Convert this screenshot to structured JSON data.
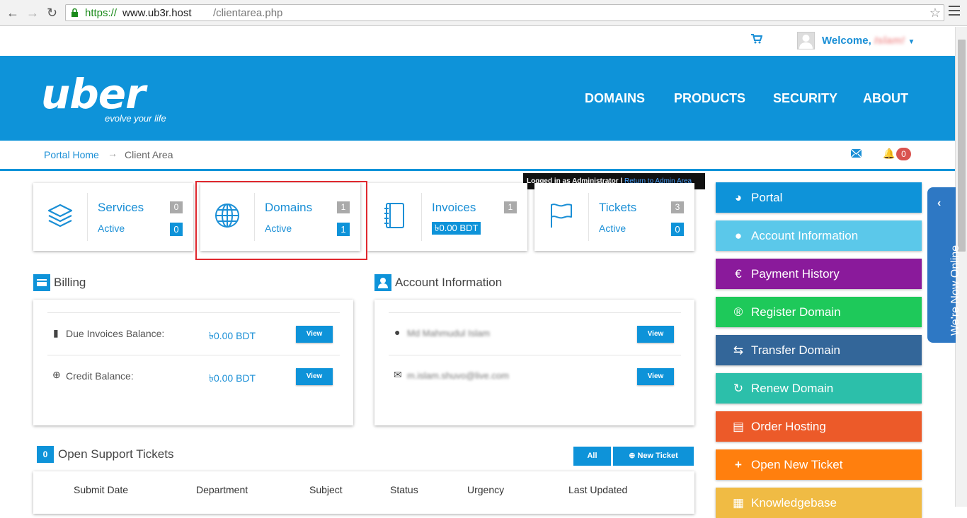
{
  "browser": {
    "url_scheme": "https://",
    "url_host": "www.ub3r.host",
    "url_path": "/clientarea.php"
  },
  "topbar": {
    "welcome_label": "Welcome,",
    "username": "Islam!"
  },
  "logo": {
    "wordmark": "uber",
    "tagline": "evolve your life"
  },
  "nav": [
    "DOMAINS",
    "PRODUCTS",
    "SECURITY",
    "ABOUT"
  ],
  "breadcrumb": {
    "home": "Portal Home",
    "separator": "→",
    "current": "Client Area"
  },
  "notifications": {
    "count": "0"
  },
  "admin_banner": {
    "text": "Logged in as Administrator",
    "separator": "|",
    "link": "Return to Admin Area"
  },
  "tiles": [
    {
      "title": "Services",
      "count": "0",
      "sub": "Active",
      "value": "0",
      "icon": "layers-icon"
    },
    {
      "title": "Domains",
      "count": "1",
      "sub": "Active",
      "value": "1",
      "icon": "globe-icon"
    },
    {
      "title": "Invoices",
      "count": "1",
      "amount": "৳0.00 BDT",
      "icon": "notebook-icon"
    },
    {
      "title": "Tickets",
      "count": "3",
      "sub": "Active",
      "value": "0",
      "icon": "flag-icon"
    }
  ],
  "billing": {
    "title": "Billing",
    "rows": [
      {
        "label": "Due Invoices Balance:",
        "value": "৳0.00 BDT",
        "button": "View"
      },
      {
        "label": "Credit Balance:",
        "value": "৳0.00 BDT",
        "button": "View"
      }
    ]
  },
  "account": {
    "title": "Account Information",
    "rows": [
      {
        "value": "Md Mahmudul Islam",
        "button": "View"
      },
      {
        "value": "m.islam.shuvo@live.com",
        "button": "View"
      }
    ]
  },
  "tickets_section": {
    "count": "0",
    "title": "Open Support Tickets",
    "all_button": "All",
    "new_button": "New Ticket",
    "columns": [
      "Submit Date",
      "Department",
      "Subject",
      "Status",
      "Urgency",
      "Last Updated"
    ]
  },
  "sidebar": [
    {
      "label": "Portal",
      "color": "#0e93d9",
      "icon": "dashboard-icon"
    },
    {
      "label": "Account Information",
      "color": "#5bc8ea",
      "icon": "user-icon"
    },
    {
      "label": "Payment History",
      "color": "#8a1a9b",
      "icon": "euro-icon"
    },
    {
      "label": "Register Domain",
      "color": "#1ec95a",
      "icon": "register-icon"
    },
    {
      "label": "Transfer Domain",
      "color": "#336699",
      "icon": "transfer-icon"
    },
    {
      "label": "Renew Domain",
      "color": "#2cbfaa",
      "icon": "renew-icon"
    },
    {
      "label": "Order Hosting",
      "color": "#ec5a29",
      "icon": "server-icon"
    },
    {
      "label": "Open New Ticket",
      "color": "#ff7f0e",
      "icon": "plus-icon"
    },
    {
      "label": "Knowledgebase",
      "color": "#f0bb44",
      "icon": "book-icon"
    }
  ],
  "chat": {
    "label": "We're Now Online"
  }
}
